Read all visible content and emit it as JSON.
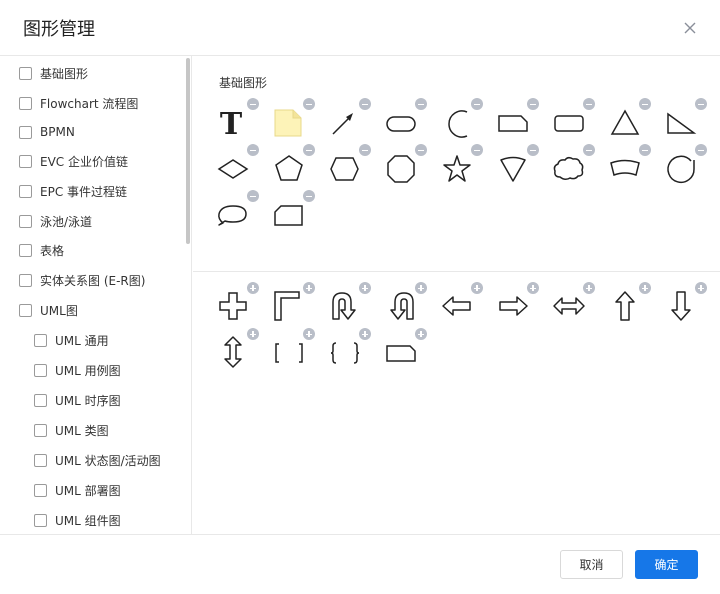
{
  "dialog": {
    "title": "图形管理",
    "close_icon": "close-icon"
  },
  "sidebar": {
    "items": [
      {
        "label": "基础图形",
        "checked": false
      },
      {
        "label": "Flowchart 流程图",
        "checked": false
      },
      {
        "label": "BPMN",
        "checked": false
      },
      {
        "label": "EVC 企业价值链",
        "checked": false
      },
      {
        "label": "EPC 事件过程链",
        "checked": false
      },
      {
        "label": "泳池/泳道",
        "checked": false
      },
      {
        "label": "表格",
        "checked": false
      },
      {
        "label": "实体关系图 (E-R图)",
        "checked": false
      },
      {
        "label": "UML图",
        "checked": false
      },
      {
        "label": "UML 通用",
        "checked": false
      },
      {
        "label": "UML 用例图",
        "checked": false
      },
      {
        "label": "UML 时序图",
        "checked": false
      },
      {
        "label": "UML 类图",
        "checked": false
      },
      {
        "label": "UML 状态图/活动图",
        "checked": false
      },
      {
        "label": "UML 部署图",
        "checked": false
      },
      {
        "label": "UML 组件图",
        "checked": false
      }
    ]
  },
  "main": {
    "section_title": "基础图形",
    "basic_shapes": [
      "text-icon",
      "note-icon",
      "arrow-line-icon",
      "rounded-rect-icon",
      "arc-icon",
      "rect-icon",
      "rounded-rect-icon",
      "triangle-icon",
      "right-triangle-icon",
      "diamond-icon",
      "pentagon-icon",
      "hexagon-icon",
      "octagon-icon",
      "star-icon",
      "sector-icon",
      "cloud-icon",
      "curved-rect-icon",
      "arc-circle-icon",
      "speech-bubble-icon",
      "folder-tab-icon"
    ],
    "other_shapes": [
      "cross-icon",
      "corner-icon",
      "u-turn-down-icon",
      "u-turn-left-icon",
      "arrow-left-icon",
      "arrow-right-icon",
      "arrow-left-right-icon",
      "arrow-up-icon",
      "arrow-down-icon",
      "arrow-up-down-icon",
      "bracket-icon",
      "brace-icon",
      "rect-icon"
    ]
  },
  "footer": {
    "cancel_label": "取消",
    "ok_label": "确定",
    "ok_color": "#1677e8"
  }
}
